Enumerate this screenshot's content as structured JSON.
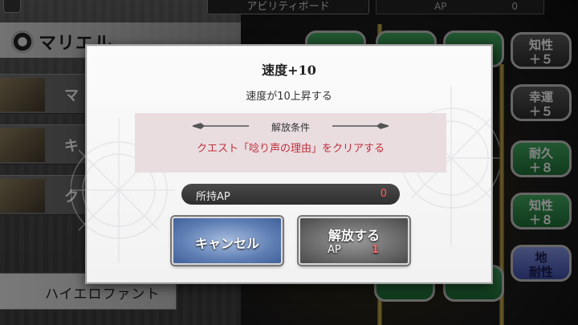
{
  "background": {
    "top_title": "アビリティボード",
    "top_ap_label": "AP",
    "top_ap_value": "0",
    "character_name": "マリエル",
    "left_items": [
      "マ",
      "キ",
      "ク"
    ],
    "bottom_item": "ハイエロファント",
    "nodes": [
      {
        "label": "知性\n＋５"
      },
      {
        "label": "幸運\n＋５"
      },
      {
        "label": "耐久\n＋８"
      },
      {
        "label": "知性\n＋８"
      },
      {
        "label": "地\n耐性"
      }
    ]
  },
  "dialog": {
    "title": "速度+10",
    "description": "速度が10上昇する",
    "condition_heading": "解放条件",
    "condition_text": "クエスト「唸り声の理由」をクリアする",
    "owned_ap_label": "所持AP",
    "owned_ap_value": "0",
    "cancel_label": "キャンセル",
    "release_label": "解放する",
    "release_ap_label": "AP",
    "release_ap_value": "1"
  },
  "colors": {
    "condition_text": "#c0303c",
    "ap_value": "#ff5a5a",
    "cancel_button": "#5f7fb4",
    "release_button": "#6a6a6a"
  }
}
